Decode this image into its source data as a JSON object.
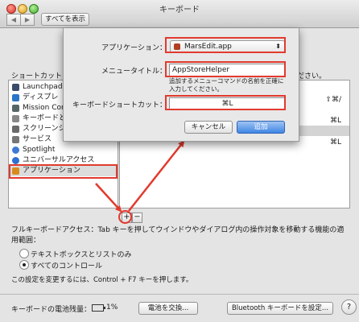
{
  "window": {
    "title": "キーボード",
    "show_all_label": "すべてを表示",
    "back_glyph": "◀",
    "forward_glyph": "▶"
  },
  "shortcuts": {
    "left_label": "ショートカット",
    "right_label": "ください。",
    "categories": [
      {
        "label": "Launchpad",
        "icon": "launchpad-icon",
        "color": "#3a4a6a"
      },
      {
        "label": "ディスプレ",
        "icon": "display-icon",
        "color": "#2a74c9"
      },
      {
        "label": "Mission Con",
        "icon": "mission-control-icon",
        "color": "#566"
      },
      {
        "label": "キーボードと",
        "icon": "keyboard-icon",
        "color": "#888"
      },
      {
        "label": "スクリーンシ",
        "icon": "screenshot-icon",
        "color": "#6a6a6a"
      },
      {
        "label": "サービス",
        "icon": "gear-icon",
        "color": "#777"
      },
      {
        "label": "Spotlight",
        "icon": "spotlight-icon",
        "color": "#3d7ad6"
      },
      {
        "label": "ユニバーサルアクセス",
        "icon": "accessibility-icon",
        "color": "#2f6fd0"
      },
      {
        "label": "アプリケーション",
        "icon": "app-shortcuts-icon",
        "color": "#d98a1e"
      }
    ],
    "table_rows": [
      {
        "key": "⇧⌘/"
      },
      {
        "key": "⌘L"
      },
      {
        "key": ""
      },
      {
        "key": "⌘L"
      }
    ],
    "add_glyph": "+",
    "remove_glyph": "−"
  },
  "full_keyboard_access": {
    "text": "フルキーボードアクセス：Tab キーを押してウインドウやダイアログ内の操作対象を移動する機能の適用範囲：",
    "options": [
      {
        "label": "テキストボックスとリストのみ",
        "selected": false
      },
      {
        "label": "すべてのコントロール",
        "selected": true
      }
    ],
    "note": "この設定を変更するには、Control + F7 キーを押します。"
  },
  "footer": {
    "battery_label": "キーボードの電池残量：",
    "battery_value": "1%",
    "change_battery_button": "電池を交換...",
    "bluetooth_button": "Bluetooth キーボードを設定...",
    "help_glyph": "?"
  },
  "dialog": {
    "app_label": "アプリケーション：",
    "app_value": "MarsEdit.app",
    "app_icon": "marsedit-icon",
    "menu_title_label": "メニュータイトル：",
    "menu_title_value": "AppStoreHelper",
    "hint": "追加するメニューコマンドの名前を正確に入力してください。",
    "shortcut_label": "キーボードショートカット：",
    "shortcut_value": "⌘L",
    "cancel_button": "キャンセル",
    "add_button": "追加"
  },
  "colors": {
    "annotation_red": "#e23a2e",
    "selection_blue": "#3f86e4"
  }
}
